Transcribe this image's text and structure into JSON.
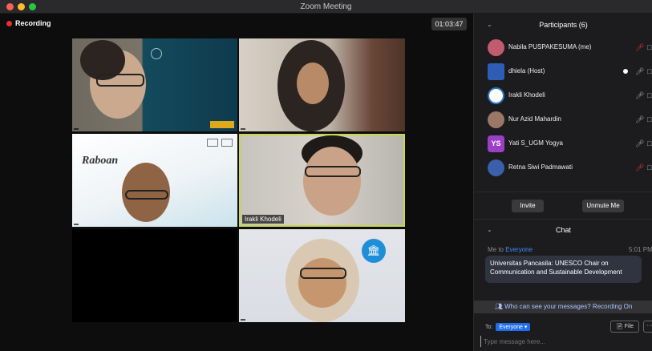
{
  "window": {
    "title": "Zoom Meeting"
  },
  "recording": {
    "label": "Recording"
  },
  "timer": {
    "value": "01:03:47"
  },
  "tiles": [
    {
      "name": ""
    },
    {
      "name": ""
    },
    {
      "name": "",
      "slide_text": "Raboan"
    },
    {
      "name": "Irakli Khodeli"
    },
    {
      "name": ""
    },
    {
      "name": ""
    }
  ],
  "participants": {
    "title": "Participants (6)",
    "items": [
      {
        "name": "Nabila PUSPAKESUMA (me)",
        "avatar": "",
        "mic": "muted"
      },
      {
        "name": "dhiela (Host)",
        "avatar": "",
        "mic": "on"
      },
      {
        "name": "Irakli Khodeli",
        "avatar": "",
        "mic": "on"
      },
      {
        "name": "Nur Azid Mahardin",
        "avatar": "",
        "mic": "on"
      },
      {
        "name": "Yati S_UGM Yogya",
        "avatar": "YS",
        "mic": "on"
      },
      {
        "name": "Retna Siwi Padmawati",
        "avatar": "",
        "mic": "muted"
      }
    ],
    "invite_label": "Invite",
    "unmute_label": "Unmute Me"
  },
  "chat": {
    "title": "Chat",
    "from": "Me to",
    "to": "Everyone",
    "time": "5:01 PM",
    "message": "Universitas Pancasila: UNESCO Chair on Communication and Sustainable Development",
    "notice": "Who can see your messages? Recording On",
    "to_label": "To:",
    "to_value": "Everyone",
    "file_label": "File",
    "more_label": "···",
    "input_placeholder": "Type message here..."
  },
  "colors": {
    "accent": "#1f6feb",
    "recording": "#e5322d",
    "active_speaker": "#c6d84a",
    "sidebar_bg": "#1c1c1e"
  }
}
